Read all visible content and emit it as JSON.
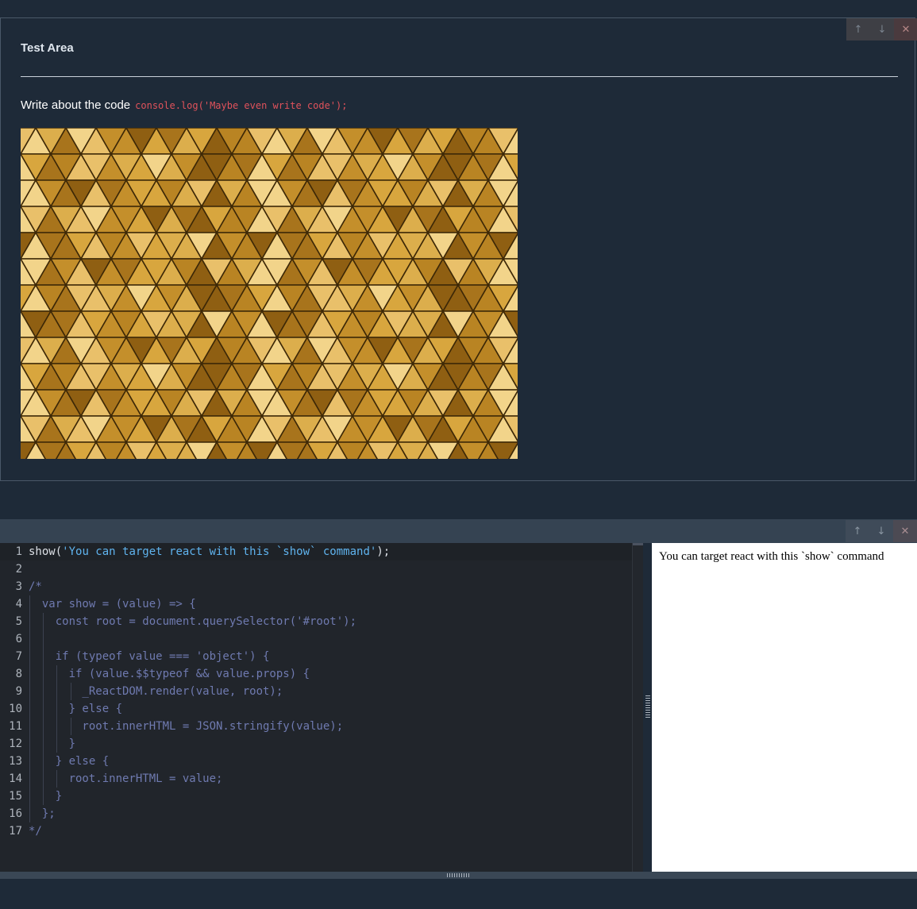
{
  "card": {
    "title": "Test Area",
    "text": "Write about the code",
    "code": "console.log('Maybe even write code');",
    "image": "gold-triangle-pattern"
  },
  "controls": {
    "up_icon": "arrow-up-icon",
    "down_icon": "arrow-down-icon",
    "close_icon": "close-icon",
    "up_glyph": "↑",
    "down_glyph": "↓",
    "close_glyph": "✕"
  },
  "editor": {
    "lines": [
      {
        "n": "1",
        "text": "show('You can target react with this `show` command');"
      },
      {
        "n": "2",
        "text": ""
      },
      {
        "n": "3",
        "text": "/*"
      },
      {
        "n": "4",
        "text": "  var show = (value) => {"
      },
      {
        "n": "5",
        "text": "    const root = document.querySelector('#root');"
      },
      {
        "n": "6",
        "text": ""
      },
      {
        "n": "7",
        "text": "    if (typeof value === 'object') {"
      },
      {
        "n": "8",
        "text": "      if (value.$$typeof && value.props) {"
      },
      {
        "n": "9",
        "text": "        _ReactDOM.render(value, root);"
      },
      {
        "n": "10",
        "text": "      } else {"
      },
      {
        "n": "11",
        "text": "        root.innerHTML = JSON.stringify(value);"
      },
      {
        "n": "12",
        "text": "      }"
      },
      {
        "n": "13",
        "text": "    } else {"
      },
      {
        "n": "14",
        "text": "      root.innerHTML = value;"
      },
      {
        "n": "15",
        "text": "    }"
      },
      {
        "n": "16",
        "text": "  };"
      },
      {
        "n": "17",
        "text": "*/"
      }
    ]
  },
  "preview": {
    "text": "You can target react with this `show` command"
  }
}
